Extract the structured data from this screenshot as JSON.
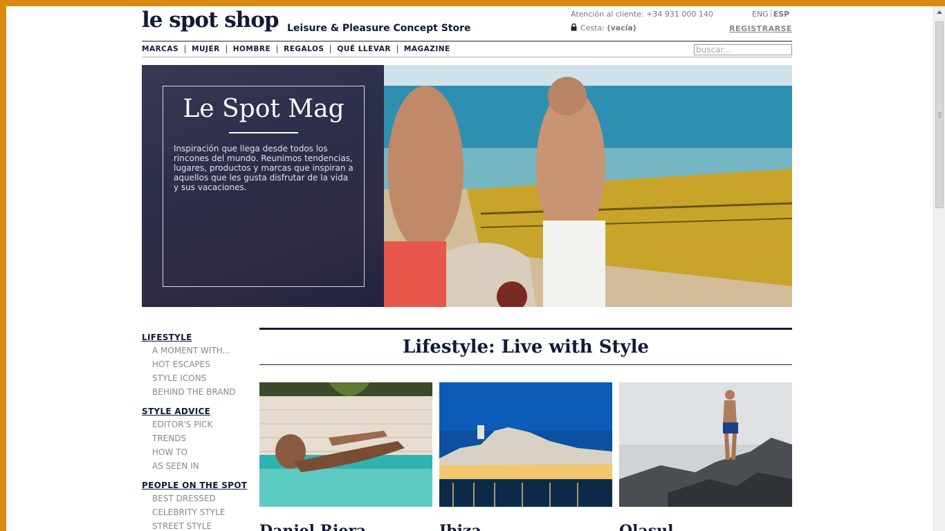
{
  "header": {
    "logo": "le spot shop",
    "tagline": "Leisure & Pleasure Concept Store",
    "customer_service": "Atención al cliente: +34 931 000 140",
    "lang_eng": "ENG",
    "lang_esp": "ESP",
    "cart_label": "Cesta:",
    "cart_status": "(vacía)",
    "register": "REGISTRARSE"
  },
  "nav": {
    "items": [
      {
        "label": "MARCAS"
      },
      {
        "label": "MUJER"
      },
      {
        "label": "HOMBRE"
      },
      {
        "label": "REGALOS"
      },
      {
        "label": "QUÉ LLEVAR"
      },
      {
        "label": "MAGAZINE"
      }
    ],
    "search_placeholder": "buscar..."
  },
  "hero": {
    "title": "Le Spot Mag",
    "text": "Inspiración que llega desde todos los rincones del mundo. Reunimos tendencias, lugares, productos y marcas que inspiran a aquellos que les gusta disfrutar de la vida y sus vacaciones."
  },
  "sidebar": {
    "sections": [
      {
        "heading": "LIFESTYLE",
        "items": [
          "A MOMENT WITH...",
          "HOT ESCAPES",
          "STYLE ICONS",
          "BEHIND THE BRAND"
        ]
      },
      {
        "heading": "STYLE ADVICE",
        "items": [
          "EDITOR'S PICK",
          "TRENDS",
          "HOW TO",
          "AS SEEN IN"
        ]
      },
      {
        "heading": "PEOPLE ON THE SPOT",
        "items": [
          "BEST DRESSED",
          "CELEBRITY STYLE",
          "STREET STYLE"
        ]
      }
    ]
  },
  "main": {
    "section_title": "Lifestyle: Live with Style",
    "cards": [
      {
        "title": "Daniel Riera"
      },
      {
        "title": "Ibiza"
      },
      {
        "title": "Olasul"
      }
    ]
  },
  "colors": {
    "brand_navy": "#121a36",
    "frame_orange": "#d88a10",
    "muted_text": "#888888"
  }
}
